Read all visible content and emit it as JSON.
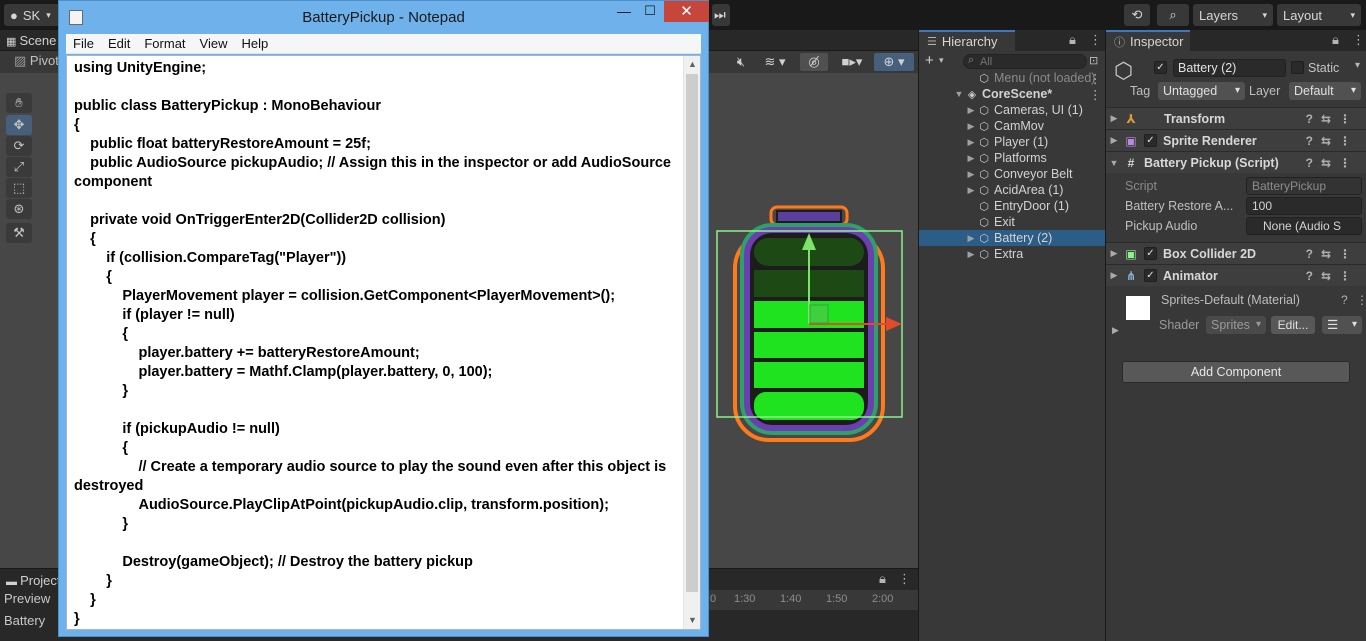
{
  "unity": {
    "account": "SK",
    "layers_label": "Layers",
    "layout_label": "Layout",
    "scene_tab": "Scene",
    "pivot_label": "Pivot",
    "project_tab": "Project",
    "preview_label": "Preview",
    "battery_label": "Battery",
    "timeline_ticks": [
      "0",
      "1:30",
      "1:40",
      "1:50",
      "2:00"
    ]
  },
  "hierarchy": {
    "tab_label": "Hierarchy",
    "search_placeholder": "All",
    "items": [
      {
        "label": "Menu (not loaded)",
        "depth": 1,
        "expandable": false,
        "selected": false,
        "dimmed": true
      },
      {
        "label": "CoreScene*",
        "depth": 0,
        "expandable": true,
        "selected": false,
        "bold": true
      },
      {
        "label": "Cameras, UI (1)",
        "depth": 1,
        "expandable": true,
        "selected": false
      },
      {
        "label": "CamMov",
        "depth": 1,
        "expandable": true,
        "selected": false
      },
      {
        "label": "Player (1)",
        "depth": 1,
        "expandable": true,
        "selected": false
      },
      {
        "label": "Platforms",
        "depth": 1,
        "expandable": true,
        "selected": false
      },
      {
        "label": "Conveyor Belt",
        "depth": 1,
        "expandable": true,
        "selected": false
      },
      {
        "label": "AcidArea (1)",
        "depth": 1,
        "expandable": true,
        "selected": false
      },
      {
        "label": "EntryDoor (1)",
        "depth": 1,
        "expandable": false,
        "selected": false
      },
      {
        "label": "Exit",
        "depth": 1,
        "expandable": false,
        "selected": false
      },
      {
        "label": "Battery (2)",
        "depth": 1,
        "expandable": true,
        "selected": true
      },
      {
        "label": "Extra",
        "depth": 1,
        "expandable": true,
        "selected": false
      }
    ]
  },
  "inspector": {
    "tab_label": "Inspector",
    "object_name": "Battery (2)",
    "static_label": "Static",
    "tag_label": "Tag",
    "tag_value": "Untagged",
    "layer_label": "Layer",
    "layer_value": "Default",
    "components": {
      "transform": "Transform",
      "sprite_renderer": "Sprite Renderer",
      "battery_pickup": "Battery Pickup (Script)",
      "box_collider": "Box Collider 2D",
      "animator": "Animator"
    },
    "script_label": "Script",
    "script_value": "BatteryPickup",
    "restore_label": "Battery Restore A...",
    "restore_value": "100",
    "pickup_audio_label": "Pickup Audio",
    "pickup_audio_value": "None (Audio S",
    "material_name": "Sprites-Default (Material)",
    "shader_label": "Shader",
    "shader_value": "Sprites",
    "edit_label": "Edit...",
    "add_component": "Add Component"
  },
  "notepad": {
    "title": "BatteryPickup - Notepad",
    "menus": [
      "File",
      "Edit",
      "Format",
      "View",
      "Help"
    ],
    "content": "using UnityEngine;\n\npublic class BatteryPickup : MonoBehaviour\n{\n    public float batteryRestoreAmount = 25f;\n    public AudioSource pickupAudio; // Assign this in the inspector or add AudioSource component\n\n    private void OnTriggerEnter2D(Collider2D collision)\n    {\n        if (collision.CompareTag(\"Player\"))\n        {\n            PlayerMovement player = collision.GetComponent<PlayerMovement>();\n            if (player != null)\n            {\n                player.battery += batteryRestoreAmount;\n                player.battery = Mathf.Clamp(player.battery, 0, 100);\n            }\n\n            if (pickupAudio != null)\n            {\n                // Create a temporary audio source to play the sound even after this object is destroyed\n                AudioSource.PlayClipAtPoint(pickupAudio.clip, transform.position);\n            }\n\n            Destroy(gameObject); // Destroy the battery pickup\n        }\n    }\n}"
  },
  "colors": {
    "battery_fill": "#1fe31f",
    "battery_dark": "#1d4a14",
    "battery_outline": "#ff7a1a",
    "selection_blue": "#2c5d87"
  }
}
